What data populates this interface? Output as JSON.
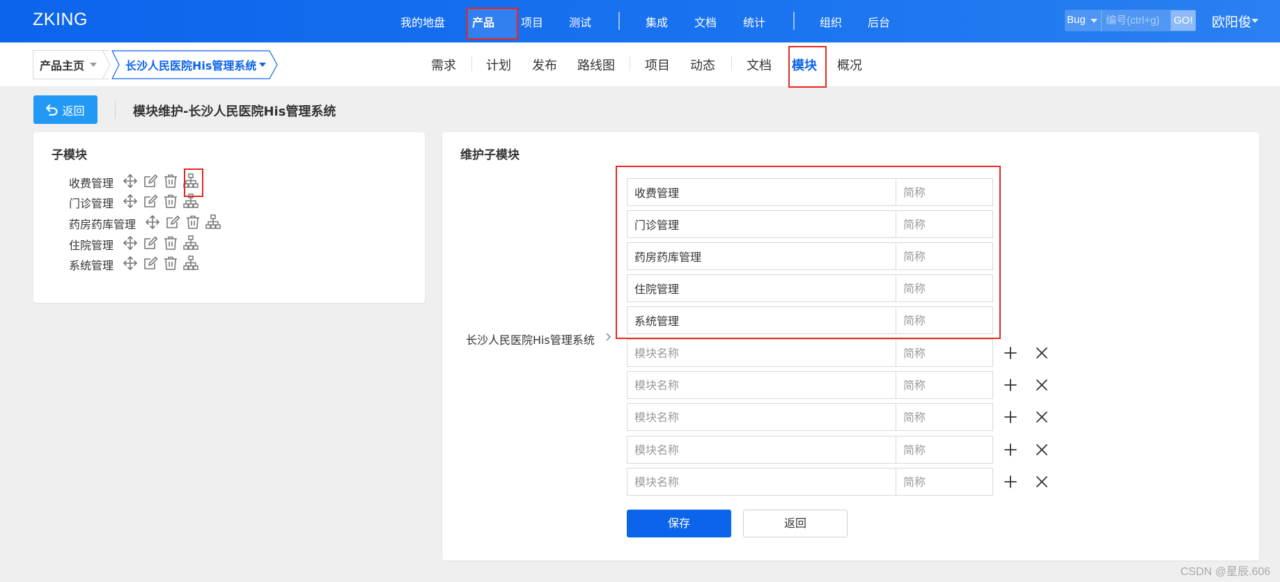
{
  "app": {
    "brand": "ZKING"
  },
  "nav": {
    "items": [
      {
        "label": "我的地盘"
      },
      {
        "label": "产品",
        "active": true
      },
      {
        "label": "项目"
      },
      {
        "label": "测试"
      },
      {
        "label": "集成"
      },
      {
        "label": "文档"
      },
      {
        "label": "统计"
      },
      {
        "label": "组织"
      },
      {
        "label": "后台"
      }
    ]
  },
  "search": {
    "type": "Bug",
    "placeholder": "编号(ctrl+g)",
    "go_label": "GO!"
  },
  "user": {
    "name": "欧阳俊"
  },
  "breadcrumb": {
    "home": "产品主页",
    "product": "长沙人民医院His管理系统"
  },
  "subnav": {
    "items": [
      {
        "label": "需求"
      },
      {
        "label": "计划"
      },
      {
        "label": "发布"
      },
      {
        "label": "路线图"
      },
      {
        "label": "项目"
      },
      {
        "label": "动态"
      },
      {
        "label": "文档"
      },
      {
        "label": "模块",
        "active": true
      },
      {
        "label": "概况"
      }
    ]
  },
  "header": {
    "back_label": "返回",
    "title": "模块维护-长沙人民医院His管理系统"
  },
  "left_panel": {
    "title": "子模块",
    "modules": [
      {
        "label": "收费管理",
        "icons": [
          "move-icon",
          "edit-icon",
          "delete-icon",
          "child-module-icon"
        ]
      },
      {
        "label": "门诊管理",
        "icons": [
          "move-icon",
          "edit-icon",
          "delete-icon",
          "child-module-icon"
        ]
      },
      {
        "label": "药房药库管理",
        "icons": [
          "move-icon",
          "edit-icon",
          "delete-icon",
          "child-module-icon"
        ]
      },
      {
        "label": "住院管理",
        "icons": [
          "move-icon",
          "edit-icon",
          "delete-icon",
          "child-module-icon"
        ]
      },
      {
        "label": "系统管理",
        "icons": [
          "move-icon",
          "edit-icon",
          "delete-icon",
          "child-module-icon"
        ]
      }
    ]
  },
  "right_panel": {
    "title": "维护子模块",
    "parent_label": "长沙人民医院His管理系统",
    "existing_rows": [
      {
        "name": "收费管理",
        "short_placeholder": "简称"
      },
      {
        "name": "门诊管理",
        "short_placeholder": "简称"
      },
      {
        "name": "药房药库管理",
        "short_placeholder": "简称"
      },
      {
        "name": "住院管理",
        "short_placeholder": "简称"
      },
      {
        "name": "系统管理",
        "short_placeholder": "简称"
      }
    ],
    "new_rows": [
      {
        "name_placeholder": "模块名称",
        "short_placeholder": "简称"
      },
      {
        "name_placeholder": "模块名称",
        "short_placeholder": "简称"
      },
      {
        "name_placeholder": "模块名称",
        "short_placeholder": "简称"
      },
      {
        "name_placeholder": "模块名称",
        "short_placeholder": "简称"
      },
      {
        "name_placeholder": "模块名称",
        "short_placeholder": "简称"
      }
    ],
    "save_label": "保存",
    "return_label": "返回"
  },
  "watermark": "CSDN @星辰.606",
  "colors": {
    "primary": "#0c64eb",
    "accent_blue": "#2399f6",
    "highlight_red": "#e8271d",
    "background": "#efefef"
  }
}
